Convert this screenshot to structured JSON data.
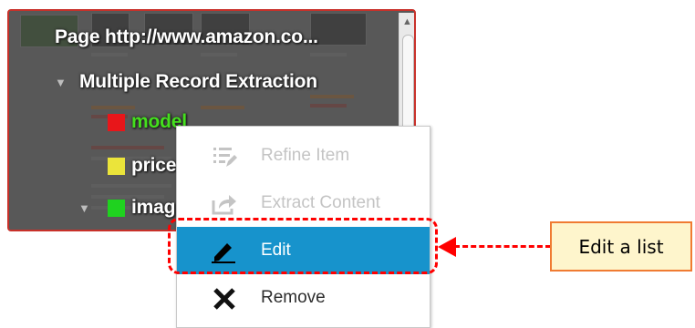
{
  "tree": {
    "page_label": "Page  http://www.amazon.co...",
    "extraction_label": "Multiple Record Extraction",
    "fields": [
      {
        "label": "model",
        "swatch_color": "#e8161a",
        "label_color": "#44e01d"
      },
      {
        "label": "price",
        "swatch_color": "#ebe43a",
        "label_color": "#ffffff"
      },
      {
        "label": "imag",
        "swatch_color": "#1fd21f",
        "label_color": "#ffffff"
      }
    ]
  },
  "context_menu": {
    "items": [
      {
        "label": "Refine Item",
        "icon": "refine-list-icon",
        "state": "disabled"
      },
      {
        "label": "Extract Content",
        "icon": "share-export-icon",
        "state": "disabled"
      },
      {
        "label": "Edit",
        "icon": "pencil-icon",
        "state": "highlighted"
      },
      {
        "label": "Remove",
        "icon": "x-icon",
        "state": "normal"
      }
    ]
  },
  "annotation": {
    "callout_text": "Edit a list",
    "highlight_color": "#ff0000",
    "callout_border_color": "#f07b32",
    "callout_fill_color": "#fef5cc"
  },
  "colors": {
    "menu_highlight": "#1793cc",
    "panel_border": "#c8312a"
  }
}
